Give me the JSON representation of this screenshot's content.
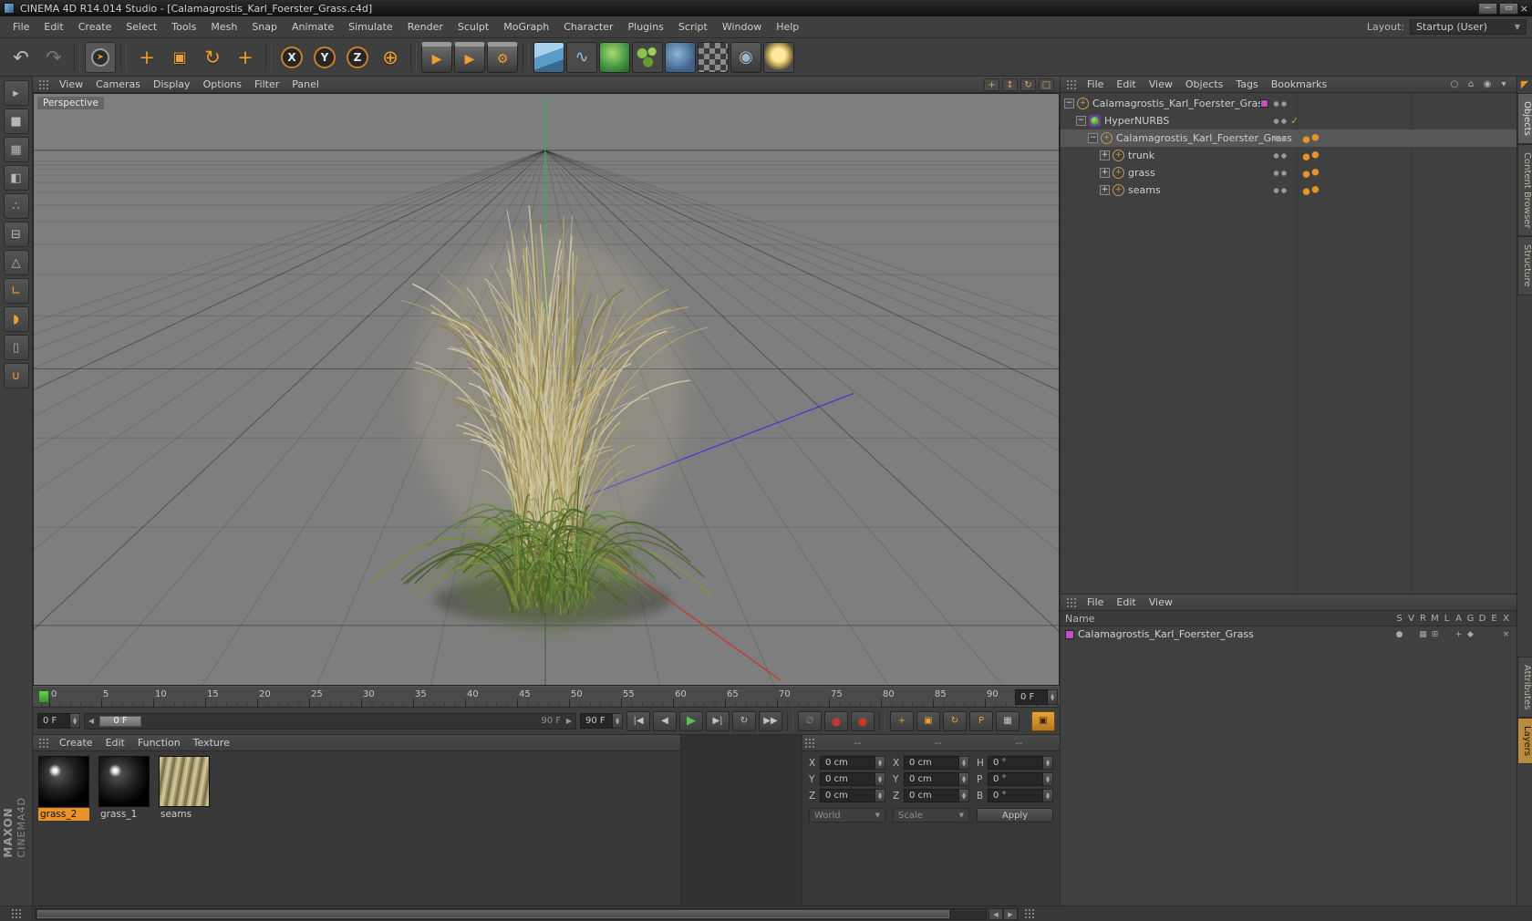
{
  "colors": {
    "accent_orange": "#F7A32B",
    "selected_material": "#E8922A",
    "axis_green": "#3DB04B",
    "axis_red": "#C23C2C",
    "axis_blue": "#4040C8",
    "check_green": "#7AC143",
    "layer_purple": "#C050C0",
    "play_green": "#5BC152",
    "record_red": "#C3392B"
  },
  "titlebar": {
    "title": "CINEMA 4D R14.014 Studio - [Calamagrostis_Karl_Foerster_Grass.c4d]",
    "buttons": [
      {
        "name": "minimize-button",
        "glyph": "−"
      },
      {
        "name": "restore-button",
        "glyph": "▭"
      },
      {
        "name": "close-button",
        "glyph": "×",
        "kind": "close"
      }
    ]
  },
  "menubar": {
    "items": [
      "File",
      "Edit",
      "Create",
      "Select",
      "Tools",
      "Mesh",
      "Snap",
      "Animate",
      "Simulate",
      "Render",
      "Sculpt",
      "MoGraph",
      "Character",
      "Plugins",
      "Script",
      "Window",
      "Help"
    ],
    "layout_label": "Layout:",
    "layout_value": "Startup (User)",
    "dropdown_arrow": "▼"
  },
  "toolbar": {
    "buttons": [
      {
        "name": "undo-button",
        "glyph": "↶",
        "kind": "plain big"
      },
      {
        "name": "redo-button",
        "glyph": "↷",
        "kind": "plain big dim"
      },
      {
        "name": "toolbar-divider-1",
        "kind": "divider",
        "inter": "false"
      },
      {
        "name": "live-selection-button",
        "glyph": "➤",
        "kind": "livesel"
      },
      {
        "name": "toolbar-divider-2",
        "kind": "divider",
        "inter": "false"
      },
      {
        "name": "move-tool-button",
        "glyph": "+",
        "kind": "orange big"
      },
      {
        "name": "scale-tool-button",
        "glyph": "▣",
        "kind": "orange"
      },
      {
        "name": "rotate-tool-button",
        "glyph": "↻",
        "kind": "orange big"
      },
      {
        "name": "last-used-tool-button",
        "glyph": "+",
        "kind": "orange big"
      },
      {
        "name": "toolbar-divider-3",
        "kind": "divider",
        "inter": "false"
      },
      {
        "name": "lock-x-axis-button",
        "glyph": "X",
        "kind": "axis"
      },
      {
        "name": "lock-y-axis-button",
        "glyph": "Y",
        "kind": "axis"
      },
      {
        "name": "lock-z-axis-button",
        "glyph": "Z",
        "kind": "axis"
      },
      {
        "name": "coordinate-system-button",
        "glyph": "⊕",
        "kind": "orange big"
      },
      {
        "name": "toolbar-divider-4",
        "kind": "divider",
        "inter": "false"
      },
      {
        "name": "render-view-button",
        "glyph": "▶",
        "kind": "clapper"
      },
      {
        "name": "render-picture-viewer-button",
        "glyph": "▶",
        "kind": "clapper"
      },
      {
        "name": "render-settings-button",
        "glyph": "⚙",
        "kind": "clapper"
      },
      {
        "name": "toolbar-divider-5",
        "kind": "divider",
        "inter": "false"
      },
      {
        "name": "add-cube-button",
        "glyph": "",
        "kind": "tile cube"
      },
      {
        "name": "add-spline-button",
        "glyph": "∿",
        "kind": "tile spline"
      },
      {
        "name": "add-hypernurbs-button",
        "glyph": "",
        "kind": "tile hnurbs"
      },
      {
        "name": "add-mograph-button",
        "glyph": "",
        "kind": "tile mograph"
      },
      {
        "name": "add-deformer-button",
        "glyph": "",
        "kind": "tile deformer"
      },
      {
        "name": "add-floor-button",
        "glyph": "",
        "kind": "tile floorobj"
      },
      {
        "name": "add-camera-button",
        "glyph": "◉",
        "kind": "tile camera"
      },
      {
        "name": "add-light-button",
        "glyph": "",
        "kind": "tile light"
      }
    ]
  },
  "left_toolbar": {
    "buttons": [
      {
        "name": "make-editable-button",
        "glyph": "▸",
        "kind": "mode"
      },
      {
        "name": "model-mode-button",
        "glyph": "■",
        "kind": "mode"
      },
      {
        "name": "texture-mode-button",
        "glyph": "▦",
        "kind": "mode"
      },
      {
        "name": "workplane-mode-button",
        "glyph": "◧",
        "kind": "mode"
      },
      {
        "name": "points-mode-button",
        "glyph": "∴",
        "kind": "mode"
      },
      {
        "name": "edges-mode-button",
        "glyph": "⊟",
        "kind": "mode"
      },
      {
        "name": "polygons-mode-button",
        "glyph": "△",
        "kind": "mode"
      },
      {
        "name": "enable-axis-button",
        "glyph": "∟",
        "kind": "mode orangeg"
      },
      {
        "name": "texture-paint-button",
        "glyph": "◗",
        "kind": "mode orangeg"
      },
      {
        "name": "workplane-lock-button",
        "glyph": "▯",
        "kind": "mode blueg"
      },
      {
        "name": "snap-button",
        "glyph": "∪",
        "kind": "mode orangeg"
      }
    ]
  },
  "viewport": {
    "menu_items": [
      "View",
      "Cameras",
      "Display",
      "Options",
      "Filter",
      "Panel"
    ],
    "nav_icons": [
      {
        "name": "pan-view-icon",
        "glyph": "+"
      },
      {
        "name": "zoom-view-icon",
        "glyph": "↕"
      },
      {
        "name": "rotate-view-icon",
        "glyph": "↻"
      },
      {
        "name": "maximize-view-icon",
        "glyph": "□"
      }
    ],
    "label": "Perspective"
  },
  "object_manager": {
    "menu_items": [
      "File",
      "Edit",
      "View",
      "Objects",
      "Tags",
      "Bookmarks"
    ],
    "corner_icons": [
      {
        "name": "search-icon",
        "glyph": "○"
      },
      {
        "name": "home-icon",
        "glyph": "⌂"
      },
      {
        "name": "eye-icon",
        "glyph": "◉"
      },
      {
        "name": "menu-arrow-icon",
        "glyph": "▾"
      }
    ],
    "tree": [
      {
        "label": "Calamagrostis_Karl_Foerster_Grass",
        "depth": 0,
        "icon": "null",
        "exp": "expanded",
        "right": "chip"
      },
      {
        "label": "HyperNURBS",
        "depth": 1,
        "icon": "hypernurbs",
        "exp": "expanded",
        "right": "check"
      },
      {
        "label": "Calamagrostis_Karl_Foerster_Grass",
        "depth": 2,
        "icon": "null",
        "exp": "expanded",
        "right": "tag",
        "selected": true
      },
      {
        "label": "trunk",
        "depth": 3,
        "icon": "null",
        "exp": "collapsed",
        "right": "tag"
      },
      {
        "label": "grass",
        "depth": 3,
        "icon": "null",
        "exp": "collapsed",
        "right": "tag"
      },
      {
        "label": "seams",
        "depth": 3,
        "icon": "null",
        "exp": "collapsed",
        "right": "tag"
      }
    ]
  },
  "layer_manager": {
    "menu_items": [
      "File",
      "Edit",
      "View"
    ],
    "name_header": "Name",
    "columns": [
      "S",
      "V",
      "R",
      "M",
      "L",
      "A",
      "G",
      "D",
      "E",
      "X"
    ],
    "row": {
      "label": "Calamagrostis_Karl_Foerster_Grass",
      "icons": [
        "●",
        "",
        "▦",
        "⊞",
        "",
        "+",
        "◆",
        "",
        "",
        "×"
      ]
    }
  },
  "right_tabs": {
    "pointer_glyph": "◤",
    "top": [
      {
        "label": "Objects",
        "active": true
      },
      {
        "label": "Content Browser"
      },
      {
        "label": "Structure"
      }
    ],
    "bottom": [
      {
        "label": "Attributes"
      },
      {
        "label": "Layers",
        "active": true
      }
    ]
  },
  "timeline": {
    "tick_labels": [
      "0",
      "5",
      "10",
      "15",
      "20",
      "25",
      "30",
      "35",
      "40",
      "45",
      "50",
      "55",
      "60",
      "65",
      "70",
      "75",
      "80",
      "85",
      "90"
    ],
    "frame_field": "0 F"
  },
  "transport": {
    "start_field": "0 F",
    "slider_thumb": "0 F",
    "slider_end_label": "90 F",
    "end_field": "90 F",
    "buttons": [
      {
        "name": "goto-start-button",
        "glyph": "|◀",
        "kind": "plain"
      },
      {
        "name": "previous-frame-button",
        "glyph": "◀",
        "kind": "plain"
      },
      {
        "name": "play-forwards-button",
        "glyph": "▶",
        "kind": "play"
      },
      {
        "name": "next-frame-button",
        "glyph": "▶|",
        "kind": "plain"
      },
      {
        "name": "cycle-mode-button",
        "glyph": "↻",
        "kind": "plain"
      },
      {
        "name": "goto-end-button",
        "glyph": "▶▶",
        "kind": "plain"
      },
      {
        "name": "transport-divider-1",
        "glyph": "",
        "kind": "gap",
        "inter": "false"
      },
      {
        "name": "keyframe-mode-button",
        "glyph": "∅",
        "kind": "dim"
      },
      {
        "name": "record-keyframe-button",
        "glyph": "●",
        "kind": "rec"
      },
      {
        "name": "autokeying-button",
        "glyph": "●",
        "kind": "rec"
      },
      {
        "name": "transport-divider-2",
        "glyph": "",
        "kind": "gap",
        "inter": "false"
      },
      {
        "name": "record-position-button",
        "glyph": "+",
        "kind": "orange"
      },
      {
        "name": "record-scale-button",
        "glyph": "▣",
        "kind": "orange"
      },
      {
        "name": "record-rotation-button",
        "glyph": "↻",
        "kind": "orange"
      },
      {
        "name": "record-parameter-button",
        "glyph": "P",
        "kind": "orange"
      },
      {
        "name": "keyframe-selection-button",
        "glyph": "▦",
        "kind": "plain"
      },
      {
        "name": "solo-button",
        "glyph": "▣",
        "kind": "orangetile solo"
      }
    ]
  },
  "materials": {
    "menu_items": [
      "Create",
      "Edit",
      "Function",
      "Texture"
    ],
    "items": [
      {
        "name": "grass_2",
        "kind": "sphere",
        "selected": true
      },
      {
        "name": "grass_1",
        "kind": "sphere"
      },
      {
        "name": "seams",
        "kind": "texture"
      }
    ]
  },
  "coordinates": {
    "headers": [
      "--",
      "--",
      "--"
    ],
    "fields": [
      {
        "label": "X",
        "value": "0 cm"
      },
      {
        "label": "X",
        "value": "0 cm"
      },
      {
        "label": "H",
        "value": "0 °"
      },
      {
        "label": "Y",
        "value": "0 cm"
      },
      {
        "label": "Y",
        "value": "0 cm"
      },
      {
        "label": "P",
        "value": "0 °"
      },
      {
        "label": "Z",
        "value": "0 cm"
      },
      {
        "label": "Z",
        "value": "0 cm"
      },
      {
        "label": "B",
        "value": "0 °"
      }
    ],
    "mode_position": "World",
    "mode_size": "Scale",
    "apply_label": "Apply"
  },
  "branding": {
    "line1": "MAXON",
    "line2": "CINEMA4D"
  }
}
